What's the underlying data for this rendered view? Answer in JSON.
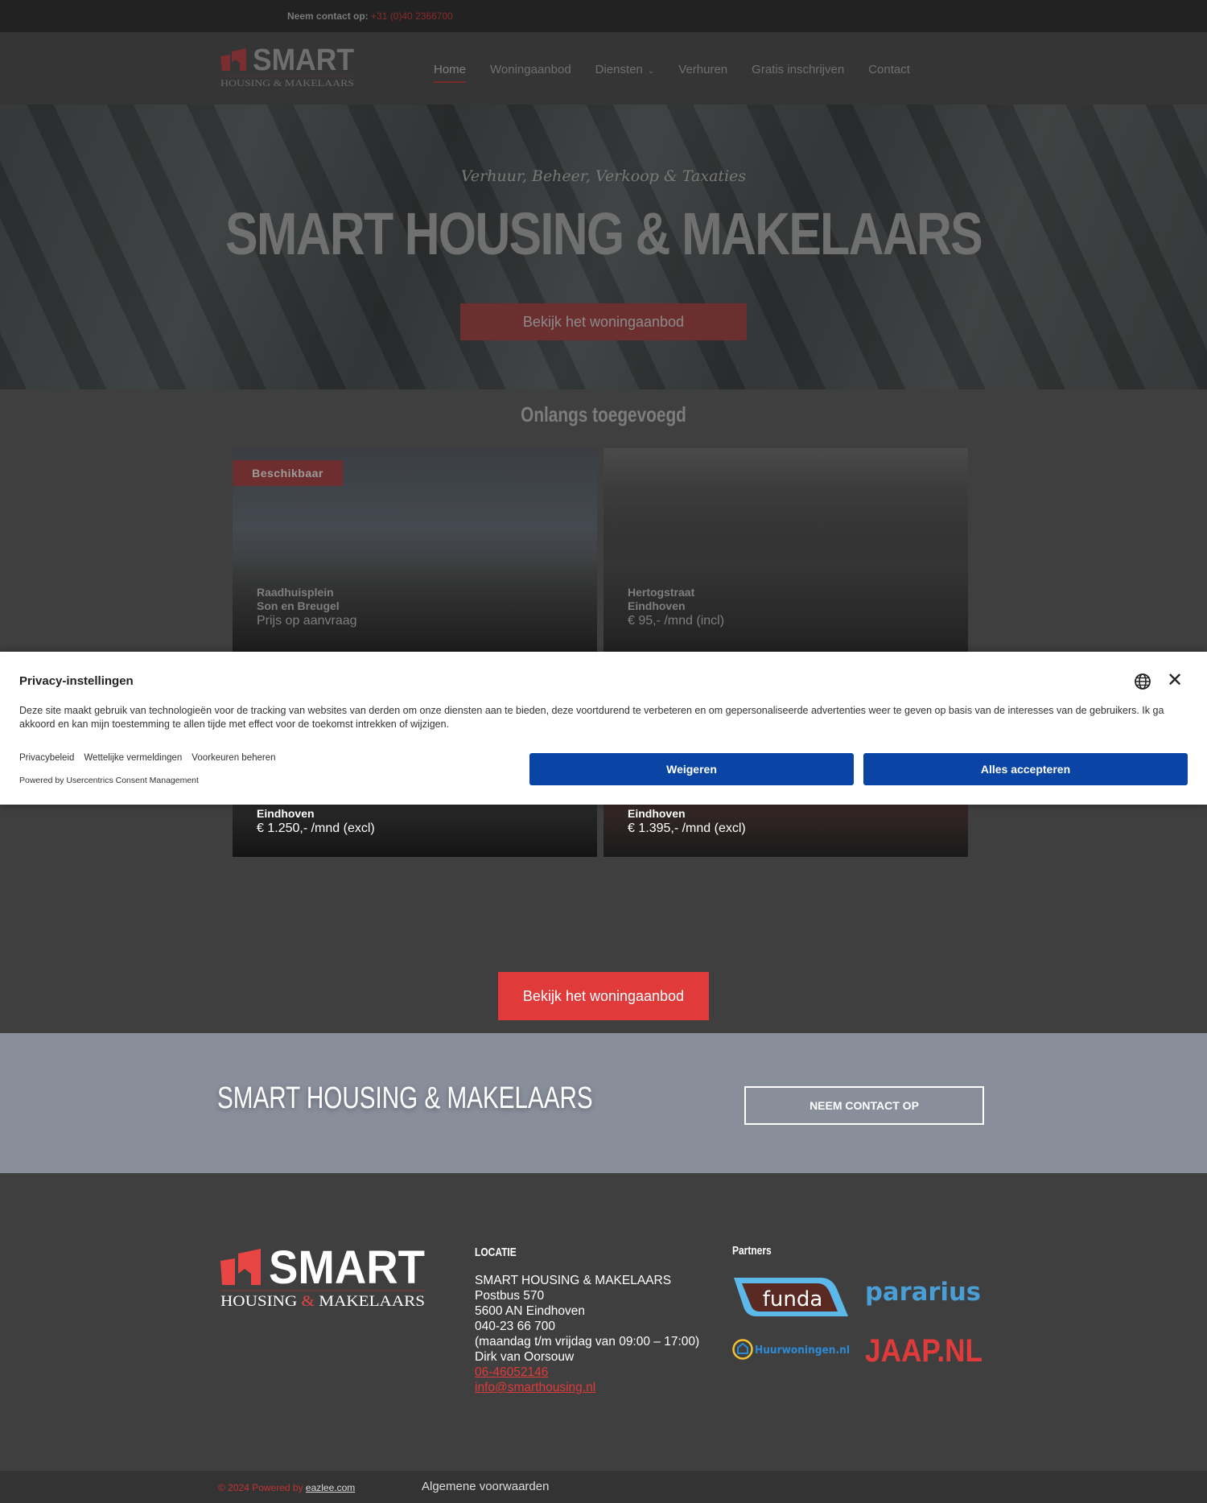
{
  "topbar": {
    "contact_label": "Neem contact op:",
    "phone": "+31 (0)40 2366700"
  },
  "brand": {
    "logo_word": "SMART",
    "logo_sub_1": "HOUSING",
    "logo_amp": "&",
    "logo_sub_2": "MAKELAARS"
  },
  "nav": {
    "items": [
      {
        "label": "Home",
        "active": true
      },
      {
        "label": "Woningaanbod"
      },
      {
        "label": "Diensten",
        "dropdown": true
      },
      {
        "label": "Verhuren"
      },
      {
        "label": "Gratis inschrijven"
      },
      {
        "label": "Contact"
      }
    ],
    "dropdown_icon": "chevron-down-icon"
  },
  "hero": {
    "tagline": "Verhuur, Beheer, Verkoop & Taxaties",
    "title": "SMART HOUSING & MAKELAARS",
    "cta_label": "Bekijk het woningaanbod"
  },
  "recent": {
    "title": "Onlangs toegevoegd",
    "listings": [
      {
        "badge": "Beschikbaar",
        "street": "Raadhuisplein",
        "city": "Son en Breugel",
        "price": "Prijs op aanvraag"
      },
      {
        "street": "Hertogstraat",
        "city": "Eindhoven",
        "price": "€ 95,- /mnd (incl)"
      },
      {
        "city": "Eindhoven",
        "price": "€ 1.250,- /mnd (excl)"
      },
      {
        "city": "Eindhoven",
        "price": "€ 1.395,- /mnd (excl)"
      }
    ],
    "cta_label": "Bekijk het woningaanbod"
  },
  "privacy": {
    "title": "Privacy-instellingen",
    "description": "Deze site maakt gebruik van technologieën voor de tracking van websites van derden om onze diensten aan te bieden, deze voortdurend te verbeteren en om gepersonaliseerde advertenties weer te geven op basis van de interesses van de gebruikers. Ik ga akkoord en kan mijn toestemming te allen tijde met effect voor de toekomst intrekken of wijzigen.",
    "links": [
      "Privacybeleid",
      "Wettelijke vermeldingen",
      "Voorkeuren beheren"
    ],
    "powered_by": "Powered by Usercentrics Consent Management",
    "refuse_label": "Weigeren",
    "accept_label": "Alles accepteren",
    "language_icon": "globe-icon",
    "close_icon": "close-icon",
    "button_color": "#0a45a6"
  },
  "band": {
    "title": "SMART HOUSING & MAKELAARS",
    "button_label": "NEEM CONTACT OP"
  },
  "footer": {
    "location_title": "LOCATIE",
    "address_lines": [
      "SMART HOUSING & MAKELAARS",
      "Postbus 570",
      "5600 AN Eindhoven",
      "040-23 66 700",
      "(maandag t/m vrijdag van 09:00 – 17:00)",
      "Dirk van Oorsouw"
    ],
    "mobile": "06-46052146",
    "email": "info@smarthousing.nl",
    "partners_title": "Partners",
    "partners": [
      "funda",
      "pararius",
      "Huurwoningen.nl",
      "JAAP.NL"
    ],
    "copyright": "© 2024 Powered by",
    "powered_link": "eazlee.com",
    "terms_label": "Algemene voorwaarden"
  },
  "colors": {
    "accent": "#e03a3a",
    "band": "#898e9b",
    "background": "#3f3f3f"
  }
}
